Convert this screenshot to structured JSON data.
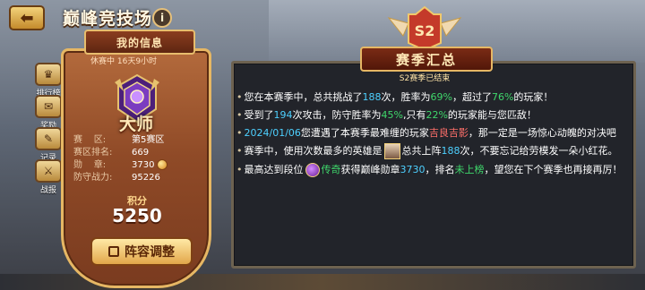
{
  "header": {
    "title": "巅峰竞技场",
    "back_icon": "back-arrow-icon",
    "info_label": "i"
  },
  "side_nav": [
    {
      "label": "排行榜",
      "icon": "trophy-icon"
    },
    {
      "label": "奖励",
      "icon": "gift-icon"
    },
    {
      "label": "记录",
      "icon": "book-icon"
    },
    {
      "label": "战报",
      "icon": "battle-icon"
    }
  ],
  "my_info": {
    "banner": "我的信息",
    "rest_status": "休赛中 16天9小时",
    "rank_title": "大师",
    "stats": [
      {
        "label": "赛    区:",
        "value": "第5赛区"
      },
      {
        "label": "赛区排名:",
        "value": "669"
      },
      {
        "label": "勋    章:",
        "value": "3730"
      },
      {
        "label": "防守战力:",
        "value": "95226"
      }
    ],
    "score_label": "积分",
    "score_value": "5250",
    "lineup_button": "阵容调整"
  },
  "season": {
    "badge": "S2",
    "title": "赛季汇总",
    "ended_text": "S2赛季已结束",
    "summary": [
      {
        "parts": [
          {
            "t": "您在本赛季中，总共挑战了"
          },
          {
            "t": "188",
            "c": "blue"
          },
          {
            "t": "次，胜率为"
          },
          {
            "t": "69%",
            "c": "green"
          },
          {
            "t": "，超过了"
          },
          {
            "t": "76%",
            "c": "green"
          },
          {
            "t": "的玩家！"
          }
        ]
      },
      {
        "parts": [
          {
            "t": "受到了"
          },
          {
            "t": "194",
            "c": "blue"
          },
          {
            "t": "次攻击，防守胜率为"
          },
          {
            "t": "45%",
            "c": "green"
          },
          {
            "t": ",只有"
          },
          {
            "t": "22%",
            "c": "green"
          },
          {
            "t": "的玩家能与您匹敌！"
          }
        ]
      },
      {
        "parts": [
          {
            "t": "2024/01/06",
            "c": "blue"
          },
          {
            "t": "您遭遇了本赛季最难缠的玩家"
          },
          {
            "t": "吉良吉影",
            "c": "red"
          },
          {
            "t": "，那一定是一场惊心动魄的对决吧"
          }
        ]
      },
      {
        "parts": [
          {
            "t": "赛季中，使用次数最多的英雄是"
          },
          {
            "avatar": true
          },
          {
            "t": "总共上阵"
          },
          {
            "t": "188",
            "c": "blue"
          },
          {
            "t": "次，不要忘记给劳模发一朵小红花。"
          }
        ]
      },
      {
        "parts": [
          {
            "t": "最高达到段位"
          },
          {
            "rank": true
          },
          {
            "t": "传奇",
            "c": "green"
          },
          {
            "t": "获得巅峰勋章"
          },
          {
            "t": "3730",
            "c": "blue"
          },
          {
            "t": "，排名"
          },
          {
            "t": "未上榜",
            "c": "green"
          },
          {
            "t": "，望您在下个赛季也再接再厉！"
          }
        ]
      }
    ]
  },
  "colors": {
    "highlight_blue": "#4dd0ff",
    "highlight_green": "#3fd76b",
    "highlight_red": "#ff6f6a",
    "gold": "#e6b764"
  }
}
